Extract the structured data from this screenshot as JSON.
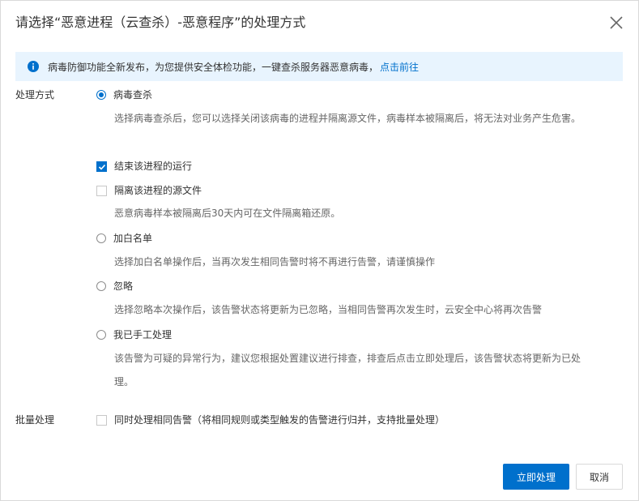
{
  "dialog": {
    "title": "请选择“恶意进程（云查杀）-恶意程序”的处理方式"
  },
  "notice": {
    "text": "病毒防御功能全新发布，为您提供安全体检功能，一键查杀服务器恶意病毒，",
    "link": "点击前往"
  },
  "handling": {
    "label": "处理方式",
    "options": [
      {
        "label": "病毒查杀",
        "selected": true,
        "desc": "选择病毒查杀后，您可以选择关闭该病毒的进程并隔离源文件，病毒样本被隔离后，将无法对业务产生危害。",
        "sub": [
          {
            "label": "结束该进程的运行",
            "checked": true
          },
          {
            "label": "隔离该进程的源文件",
            "checked": false,
            "desc": "恶意病毒样本被隔离后30天内可在文件隔离箱还原。"
          }
        ]
      },
      {
        "label": "加白名单",
        "selected": false,
        "desc": "选择加白名单操作后，当再次发生相同告警时将不再进行告警，请谨慎操作"
      },
      {
        "label": "忽略",
        "selected": false,
        "desc": "选择忽略本次操作后，该告警状态将更新为已忽略，当相同告警再次发生时，云安全中心将再次告警"
      },
      {
        "label": "我已手工处理",
        "selected": false,
        "desc": "该告警为可疑的异常行为，建议您根据处置建议进行排查，排查后点击立即处理后，该告警状态将更新为已处理。"
      }
    ]
  },
  "batch": {
    "label": "批量处理",
    "checkbox_label": "同时处理相同告警（将相同规则或类型触发的告警进行归并，支持批量处理）",
    "checked": false
  },
  "buttons": {
    "confirm": "立即处理",
    "cancel": "取消"
  },
  "colors": {
    "accent": "#0070cc",
    "notice_bg": "#e8f4fe"
  }
}
